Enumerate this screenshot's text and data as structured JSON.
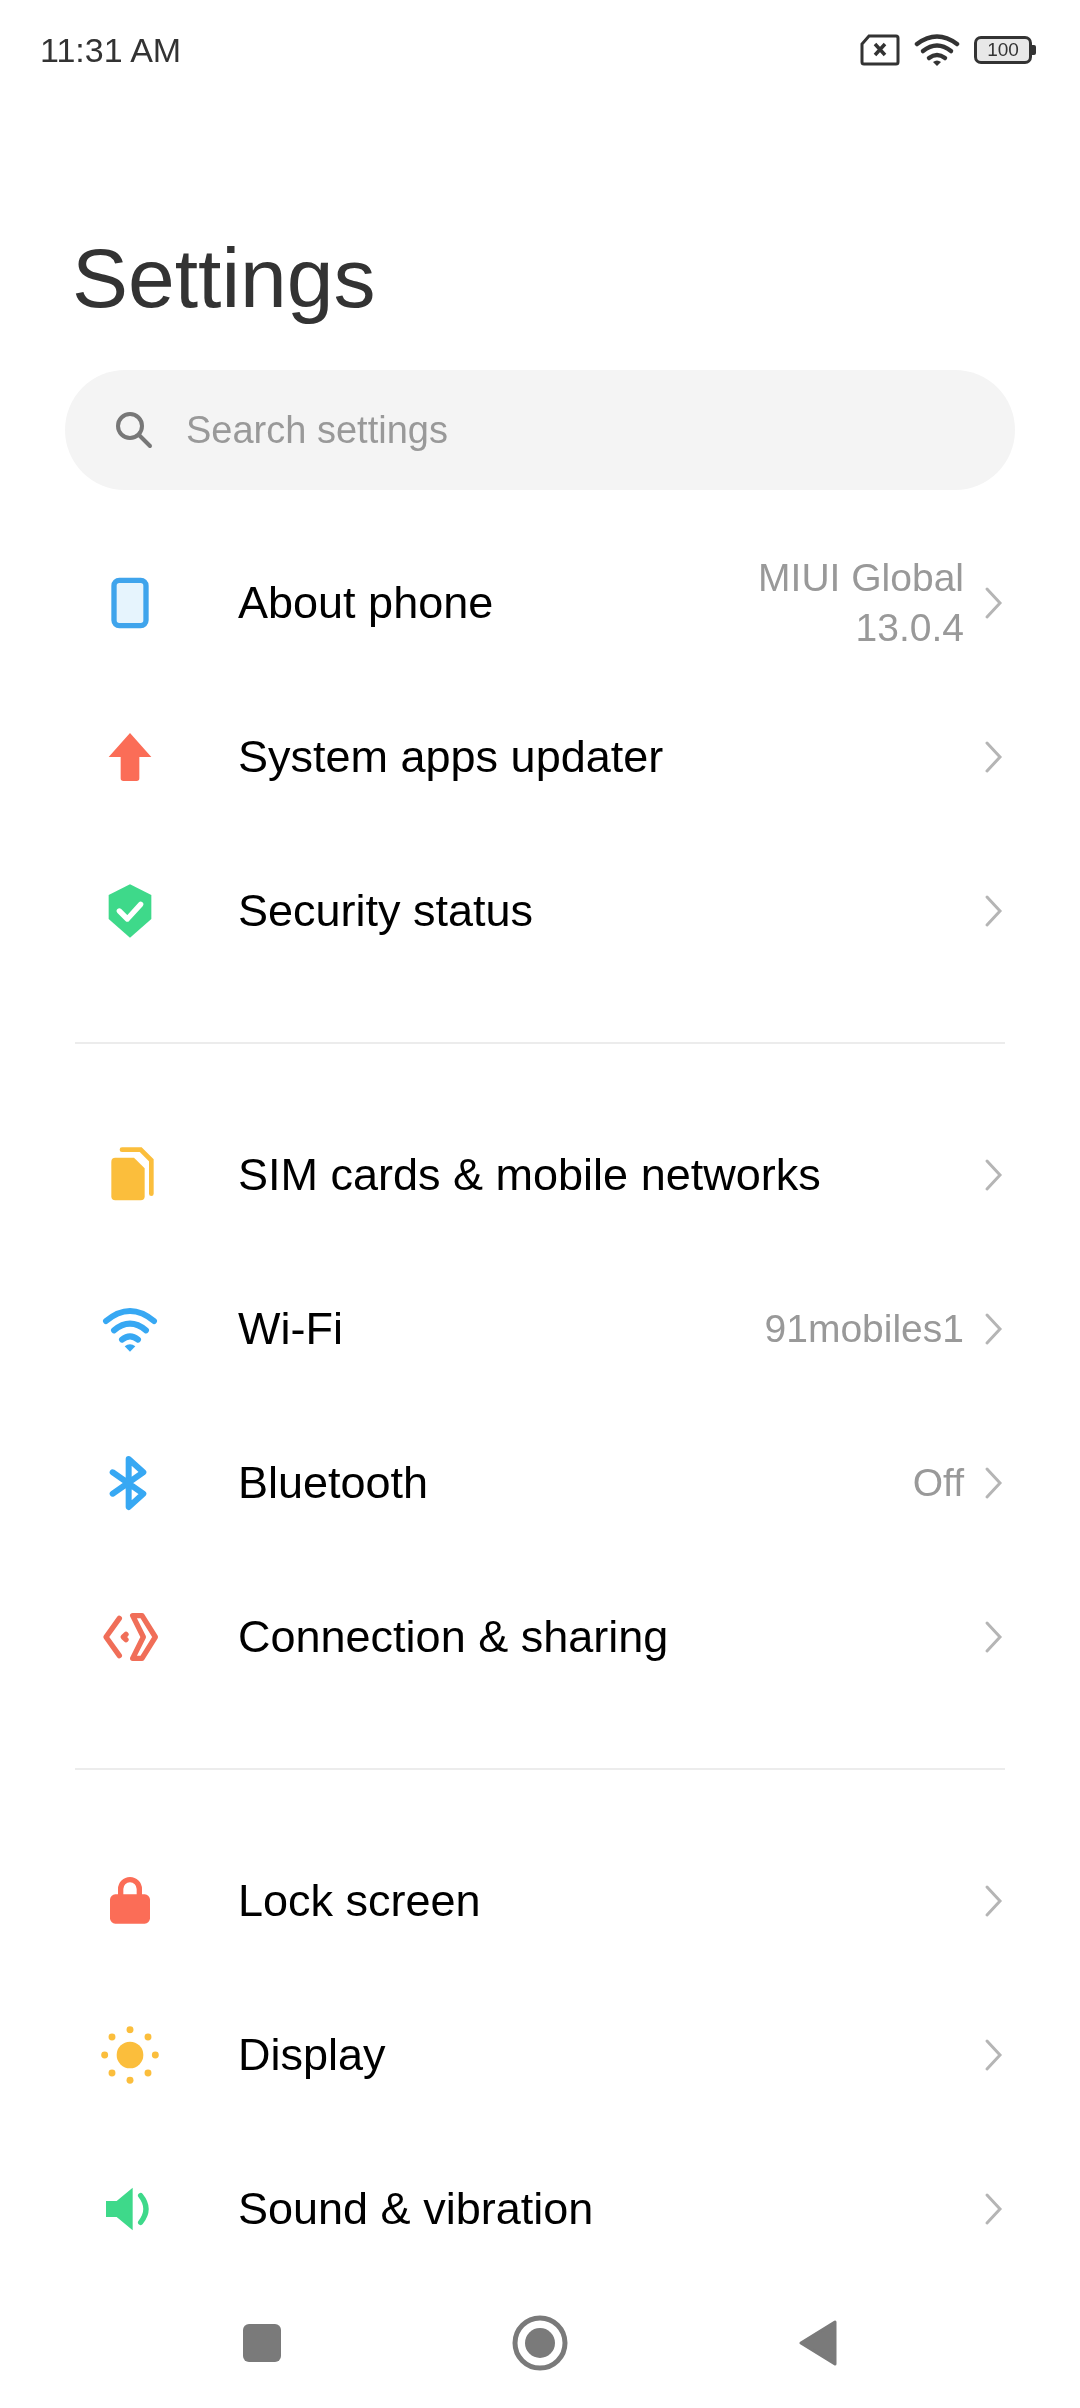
{
  "status_bar": {
    "time": "11:31 AM",
    "battery": "100"
  },
  "title": "Settings",
  "search": {
    "placeholder": "Search settings"
  },
  "sections": [
    {
      "items": [
        {
          "label": "About phone",
          "value": "MIUI Global 13.0.4"
        },
        {
          "label": "System apps updater"
        },
        {
          "label": "Security status"
        }
      ]
    },
    {
      "items": [
        {
          "label": "SIM cards & mobile networks"
        },
        {
          "label": "Wi-Fi",
          "value": "91mobiles1"
        },
        {
          "label": "Bluetooth",
          "value": "Off"
        },
        {
          "label": "Connection & sharing"
        }
      ]
    },
    {
      "items": [
        {
          "label": "Lock screen"
        },
        {
          "label": "Display"
        },
        {
          "label": "Sound & vibration"
        }
      ]
    }
  ]
}
